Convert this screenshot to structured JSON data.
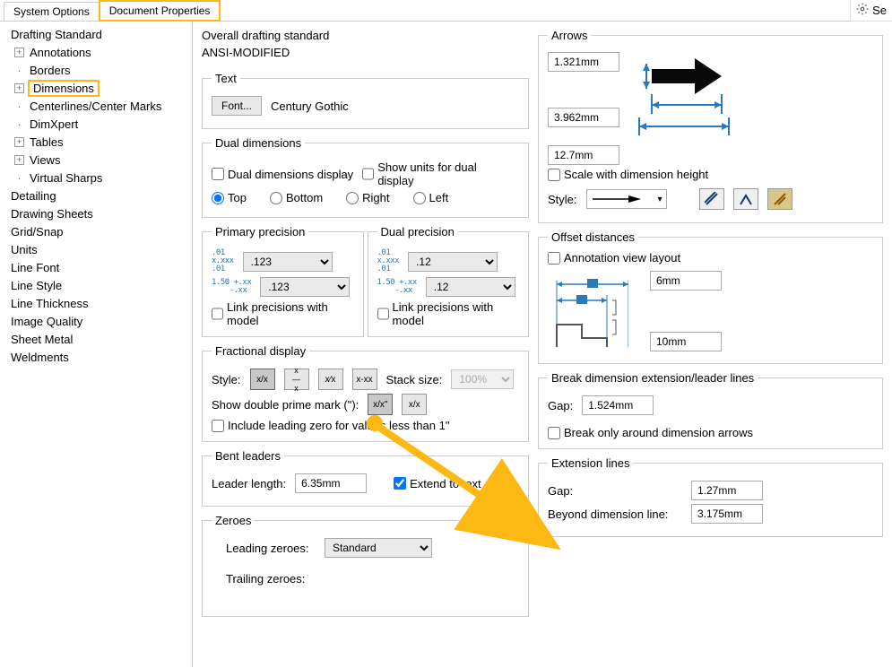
{
  "search": {
    "label": "Se"
  },
  "tabs": {
    "system_options": "System Options",
    "document_properties": "Document Properties"
  },
  "sidebar": {
    "items": [
      "Drafting Standard",
      "Annotations",
      "Borders",
      "Dimensions",
      "Centerlines/Center Marks",
      "DimXpert",
      "Tables",
      "Views",
      "Virtual Sharps",
      "Detailing",
      "Drawing Sheets",
      "Grid/Snap",
      "Units",
      "Line Font",
      "Line Style",
      "Line Thickness",
      "Image Quality",
      "Sheet Metal",
      "Weldments"
    ]
  },
  "header": {
    "overall_label": "Overall drafting standard",
    "overall_value": "ANSI-MODIFIED"
  },
  "text_group": {
    "legend": "Text",
    "font_button": "Font...",
    "font_value": "Century Gothic"
  },
  "dual_dim": {
    "legend": "Dual dimensions",
    "display": "Dual dimensions display",
    "show_units": "Show units for dual display",
    "top": "Top",
    "bottom": "Bottom",
    "right": "Right",
    "left": "Left"
  },
  "primary_precision": {
    "legend": "Primary precision",
    "val1": ".123",
    "val2": ".123",
    "link": "Link precisions with model"
  },
  "dual_precision": {
    "legend": "Dual precision",
    "val1": ".12",
    "val2": ".12",
    "link": "Link precisions with model"
  },
  "fractional": {
    "legend": "Fractional display",
    "style": "Style:",
    "stack_size": "Stack size:",
    "stack_value": "100%",
    "prime": "Show double prime mark (\"):",
    "leading_zero": "Include leading zero for values less than 1\""
  },
  "bent_leaders": {
    "legend": "Bent leaders",
    "leader_length": "Leader length:",
    "leader_value": "6.35mm",
    "extend": "Extend to text"
  },
  "zeroes": {
    "legend": "Zeroes",
    "leading": "Leading zeroes:",
    "leading_value": "Standard",
    "trailing": "Trailing zeroes:"
  },
  "arrows": {
    "legend": "Arrows",
    "v1": "1.321mm",
    "v2": "3.962mm",
    "v3": "12.7mm",
    "scale": "Scale with dimension height",
    "style": "Style:"
  },
  "offset": {
    "legend": "Offset distances",
    "annotation": "Annotation view layout",
    "v1": "6mm",
    "v2": "10mm"
  },
  "break_dim": {
    "legend": "Break dimension extension/leader lines",
    "gap": "Gap:",
    "gap_value": "1.524mm",
    "break_only": "Break only around dimension arrows"
  },
  "ext_lines": {
    "legend": "Extension lines",
    "gap": "Gap:",
    "gap_value": "1.27mm",
    "beyond": "Beyond dimension line:",
    "beyond_value": "3.175mm"
  }
}
